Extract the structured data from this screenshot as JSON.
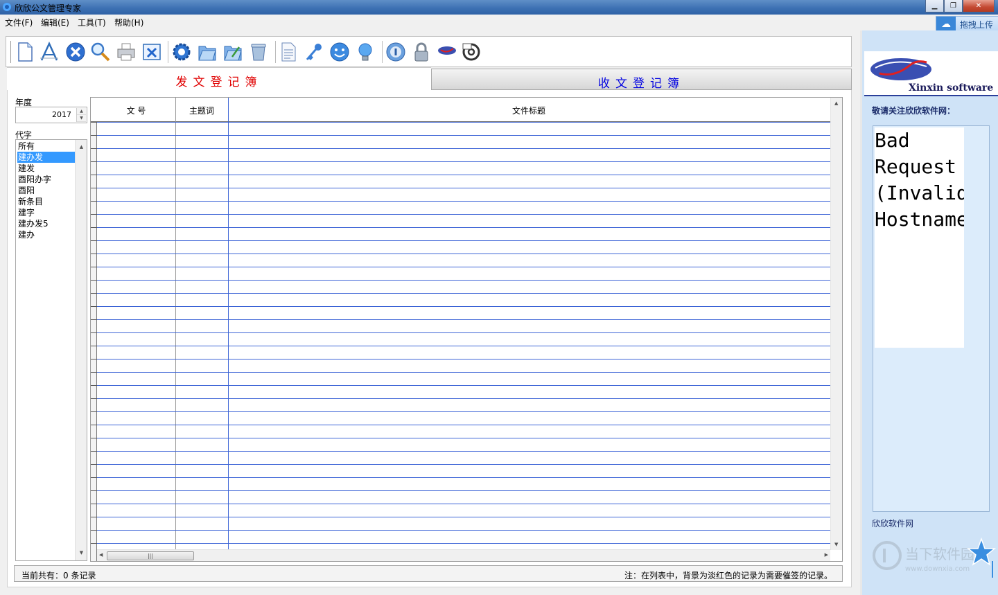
{
  "window": {
    "title": "欣欣公文管理专家"
  },
  "menu": [
    "文件(F)",
    "编辑(E)",
    "工具(T)",
    "帮助(H)"
  ],
  "upload_button": "拖拽上传",
  "toolbar": {
    "icons": [
      "new-document-icon",
      "font-icon",
      "cancel-icon",
      "search-icon",
      "print-icon",
      "export-excel-icon",
      "settings-gear-icon",
      "open-folder-icon",
      "edit-folder-icon",
      "trash-icon",
      "report-document-icon",
      "key-icon",
      "smiley-icon",
      "lightbulb-icon",
      "info-icon",
      "lock-icon",
      "xinxin-logo-icon",
      "email-icon"
    ]
  },
  "tabs": {
    "send": "发文登记簿",
    "receive": "收文登记簿"
  },
  "filters": {
    "year_label": "年度",
    "year_value": "2017",
    "code_label": "代字",
    "codes": [
      "所有",
      "建办发",
      "建发",
      "酉阳办字",
      "酉阳",
      "新条目",
      "建字",
      "建办发5",
      "建办"
    ],
    "selected_code": "建办发"
  },
  "grid": {
    "columns": [
      "文  号",
      "主题词",
      "文件标题"
    ],
    "rows": []
  },
  "status": {
    "count_text": "当前共有：0 条记录",
    "note": "注：在列表中，背景为淡红色的记录为需要催签的记录。"
  },
  "sidebar": {
    "logo_text": "Xinxin software",
    "follow_text": "敬请关注欣欣软件网：",
    "web_lines": [
      "Bad",
      "Request",
      "(Invalid",
      "Hostname"
    ],
    "link_text": "欣欣软件网",
    "watermark_text": "当下软件园",
    "watermark_url": "www.downxia.com"
  },
  "colors": {
    "send_tab": "#e00000",
    "receive_tab": "#0000e0",
    "grid_lines": "#3b63d6",
    "selection": "#3399ff"
  }
}
